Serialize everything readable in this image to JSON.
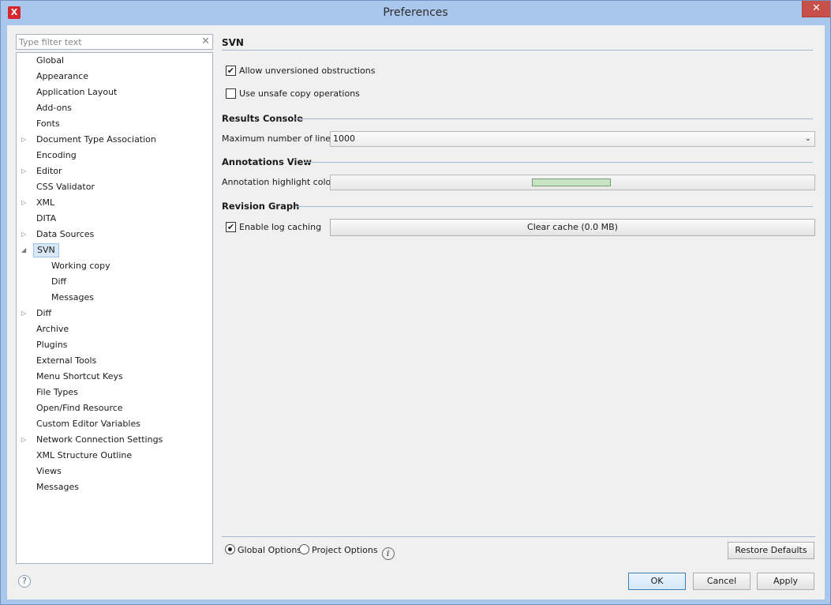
{
  "window": {
    "title": "Preferences",
    "app_icon": "X",
    "close_glyph": "✕"
  },
  "filter": {
    "placeholder": "Type filter text",
    "clear_glyph": "✕"
  },
  "tree": {
    "items": [
      {
        "label": "Global",
        "expandable": false,
        "level": 0
      },
      {
        "label": "Appearance",
        "expandable": false,
        "level": 0
      },
      {
        "label": "Application Layout",
        "expandable": false,
        "level": 0
      },
      {
        "label": "Add-ons",
        "expandable": false,
        "level": 0
      },
      {
        "label": "Fonts",
        "expandable": false,
        "level": 0
      },
      {
        "label": "Document Type Association",
        "expandable": true,
        "level": 0
      },
      {
        "label": "Encoding",
        "expandable": false,
        "level": 0
      },
      {
        "label": "Editor",
        "expandable": true,
        "level": 0
      },
      {
        "label": "CSS Validator",
        "expandable": false,
        "level": 0
      },
      {
        "label": "XML",
        "expandable": true,
        "level": 0
      },
      {
        "label": "DITA",
        "expandable": false,
        "level": 0
      },
      {
        "label": "Data Sources",
        "expandable": true,
        "level": 0
      },
      {
        "label": "SVN",
        "expandable": true,
        "expanded": true,
        "selected": true,
        "level": 0
      },
      {
        "label": "Working copy",
        "expandable": false,
        "level": 1
      },
      {
        "label": "Diff",
        "expandable": false,
        "level": 1
      },
      {
        "label": "Messages",
        "expandable": false,
        "level": 1
      },
      {
        "label": "Diff",
        "expandable": true,
        "level": 0
      },
      {
        "label": "Archive",
        "expandable": false,
        "level": 0
      },
      {
        "label": "Plugins",
        "expandable": false,
        "level": 0
      },
      {
        "label": "External Tools",
        "expandable": false,
        "level": 0
      },
      {
        "label": "Menu Shortcut Keys",
        "expandable": false,
        "level": 0
      },
      {
        "label": "File Types",
        "expandable": false,
        "level": 0
      },
      {
        "label": "Open/Find Resource",
        "expandable": false,
        "level": 0
      },
      {
        "label": "Custom Editor Variables",
        "expandable": false,
        "level": 0
      },
      {
        "label": "Network Connection Settings",
        "expandable": true,
        "level": 0
      },
      {
        "label": "XML Structure Outline",
        "expandable": false,
        "level": 0
      },
      {
        "label": "Views",
        "expandable": false,
        "level": 0
      },
      {
        "label": "Messages",
        "expandable": false,
        "level": 0
      }
    ],
    "collapsed_glyph": "▷",
    "expanded_glyph": "◢"
  },
  "panel": {
    "title": "SVN",
    "allow_unversioned": {
      "label": "Allow unversioned obstructions",
      "checked": true
    },
    "unsafe_copy": {
      "label": "Use unsafe copy operations",
      "checked": false
    },
    "results_console": {
      "title": "Results Console",
      "max_lines_label": "Maximum number of lines",
      "max_lines_value": "1000"
    },
    "annotations_view": {
      "title": "Annotations View",
      "highlight_label": "Annotation highlight color",
      "highlight_color": "#c9e4c5"
    },
    "revision_graph": {
      "title": "Revision Graph",
      "log_caching": {
        "label": "Enable log caching",
        "checked": true
      },
      "clear_cache_label": "Clear cache (0.0 MB)"
    }
  },
  "footer": {
    "global_options": "Global Options",
    "project_options": "Project Options",
    "info_glyph": "i",
    "restore_defaults": "Restore Defaults",
    "ok": "OK",
    "cancel": "Cancel",
    "apply": "Apply",
    "help_glyph": "?"
  },
  "checkmark": "✔"
}
